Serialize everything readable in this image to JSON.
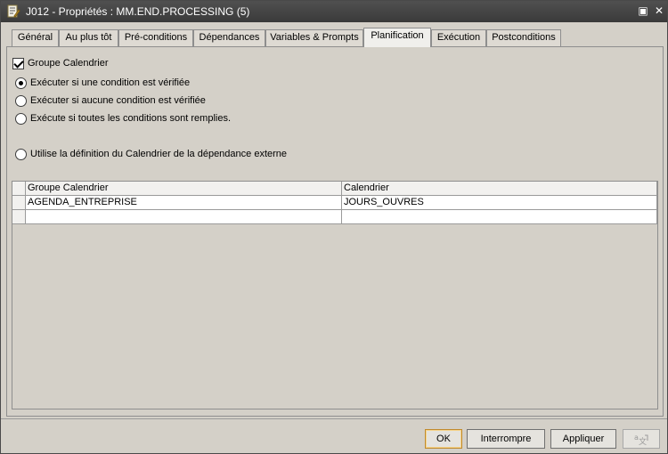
{
  "window": {
    "title": "J012 - Propriétés : MM.END.PROCESSING (5)",
    "icon": "properties-edit-icon",
    "controls": {
      "restore": "▣",
      "close": "✕"
    }
  },
  "tabs": [
    {
      "label": "Général",
      "active": false
    },
    {
      "label": "Au plus tôt",
      "active": false
    },
    {
      "label": "Pré-conditions",
      "active": false
    },
    {
      "label": "Dépendances",
      "active": false
    },
    {
      "label": "Variables & Prompts",
      "active": false
    },
    {
      "label": "Planification",
      "active": true
    },
    {
      "label": "Exécution",
      "active": false
    },
    {
      "label": "Postconditions",
      "active": false
    }
  ],
  "planification": {
    "group_checkbox": {
      "label": "Groupe Calendrier",
      "checked": true
    },
    "radios": [
      {
        "label": "Exécuter si une condition est vérifiée",
        "checked": true
      },
      {
        "label": "Exécuter si aucune condition est vérifiée",
        "checked": false
      },
      {
        "label": "Exécute si toutes les conditions sont remplies.",
        "checked": false
      },
      {
        "label": "Utilise la définition du Calendrier de la dépendance externe",
        "checked": false
      }
    ],
    "grid": {
      "columns": [
        "Groupe Calendrier",
        "Calendrier"
      ],
      "rows": [
        [
          "AGENDA_ENTREPRISE",
          "JOURS_OUVRES"
        ],
        [
          "",
          ""
        ]
      ]
    }
  },
  "buttons": {
    "ok": "OK",
    "cancel": "Interrompre",
    "apply": "Appliquer",
    "extra_icon": "translate-icon"
  },
  "colors": {
    "titlebar": "#3a3a3a",
    "default_button_border": "#c08a2e"
  }
}
